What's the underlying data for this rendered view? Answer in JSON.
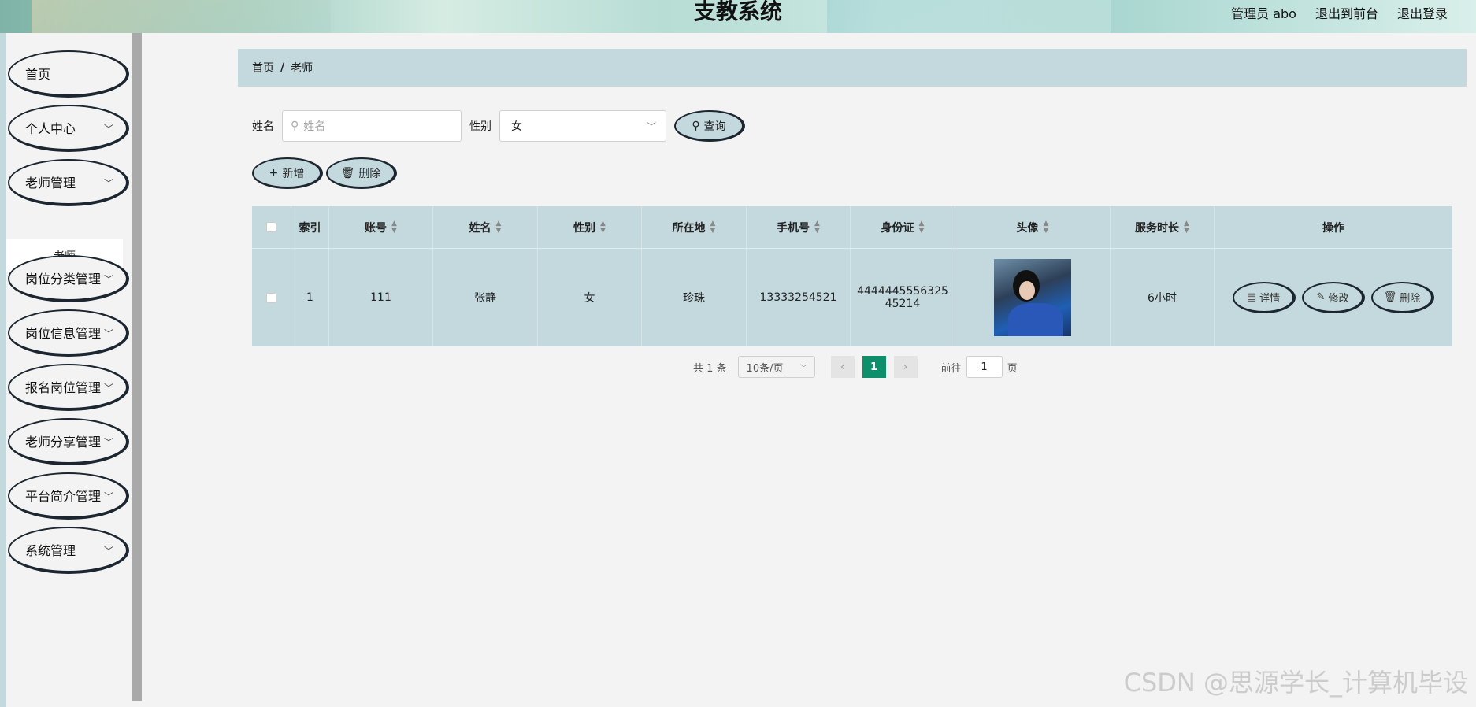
{
  "header": {
    "title": "支教系统",
    "user_label": "管理员 abo",
    "front_link": "退出到前台",
    "logout_link": "退出登录"
  },
  "sidebar": {
    "items": [
      {
        "label": "首页",
        "has_chevron": false
      },
      {
        "label": "个人中心",
        "has_chevron": true
      },
      {
        "label": "老师管理",
        "has_chevron": true,
        "expanded": true
      },
      {
        "label": "岗位分类管理",
        "has_chevron": true
      },
      {
        "label": "岗位信息管理",
        "has_chevron": true
      },
      {
        "label": "报名岗位管理",
        "has_chevron": true
      },
      {
        "label": "老师分享管理",
        "has_chevron": true
      },
      {
        "label": "平台简介管理",
        "has_chevron": true
      },
      {
        "label": "系统管理",
        "has_chevron": true
      }
    ],
    "submenu_label": "老师"
  },
  "breadcrumb": {
    "home": "首页",
    "separator": "/",
    "current": "老师"
  },
  "search": {
    "name_label": "姓名",
    "name_placeholder": "姓名",
    "gender_label": "性别",
    "gender_value": "女",
    "query_button": "查询"
  },
  "actions": {
    "add_button": "新增",
    "delete_button": "删除"
  },
  "table": {
    "columns": [
      "索引",
      "账号",
      "姓名",
      "性别",
      "所在地",
      "手机号",
      "身份证",
      "头像",
      "服务时长",
      "操作"
    ],
    "rows": [
      {
        "index": "1",
        "account": "111",
        "name": "张静",
        "gender": "女",
        "location": "珍珠",
        "phone": "13333254521",
        "id_line1": "4444445556325",
        "id_line2": "45214",
        "service_time": "6小时",
        "detail_button": "详情",
        "edit_button": "修改",
        "delete_button": "删除"
      }
    ]
  },
  "pagination": {
    "total_text": "共 1 条",
    "page_size": "10条/页",
    "current_page": "1",
    "goto_label": "前往",
    "goto_value": "1",
    "page_suffix": "页"
  },
  "watermark": "CSDN @思源学长_计算机毕设",
  "colors": {
    "accent": "#c3d9de",
    "active_page": "#0c8f6a",
    "background": "#f3f3f3"
  }
}
